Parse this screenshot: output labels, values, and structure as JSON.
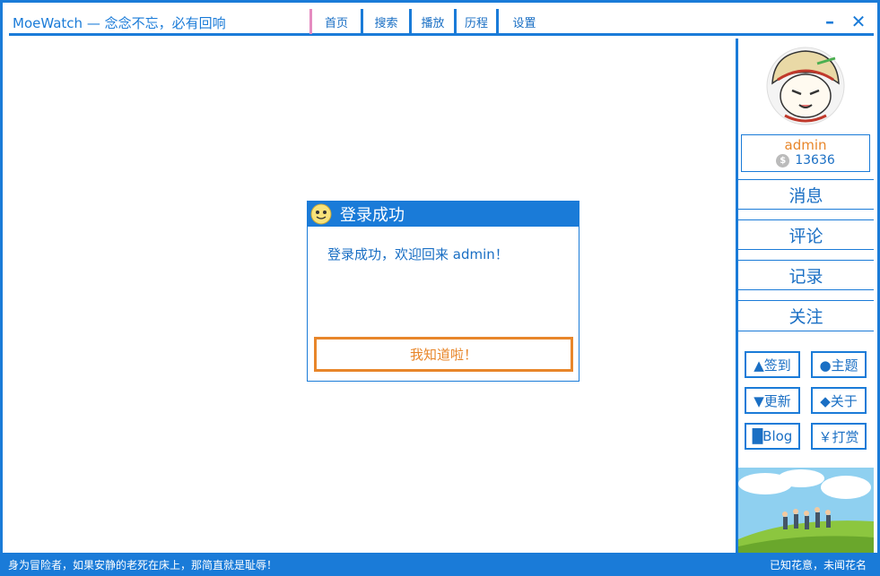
{
  "window": {
    "title": "MoeWatch — 念念不忘，必有回响",
    "minimize_glyph": "–",
    "close_glyph": "✕"
  },
  "nav": {
    "tabs": [
      {
        "label": "首页"
      },
      {
        "label": "搜索"
      },
      {
        "label": "播放"
      },
      {
        "label": "历程"
      },
      {
        "label": "设置"
      }
    ]
  },
  "user": {
    "name": "admin",
    "coin_icon": "$",
    "coins": "13636"
  },
  "sidebar": {
    "menu": [
      {
        "label": "消息"
      },
      {
        "label": "评论"
      },
      {
        "label": "记录"
      },
      {
        "label": "关注"
      }
    ],
    "buttons": [
      {
        "label": "▲签到"
      },
      {
        "label": "●主题"
      },
      {
        "label": "▼更新"
      },
      {
        "label": "◆关于"
      },
      {
        "label": "█Blog"
      },
      {
        "label": "￥打赏"
      }
    ]
  },
  "dialog": {
    "title": "登录成功",
    "message": "登录成功，欢迎回来 admin！",
    "button": "我知道啦！"
  },
  "status": {
    "left": "身为冒险者，如果安静的老死在床上，那简直就是耻辱！",
    "right": "已知花意，未闻花名"
  },
  "colors": {
    "accent": "#1a7bd8",
    "highlight": "#e8862a",
    "nav_divider": "#e58bc0"
  }
}
